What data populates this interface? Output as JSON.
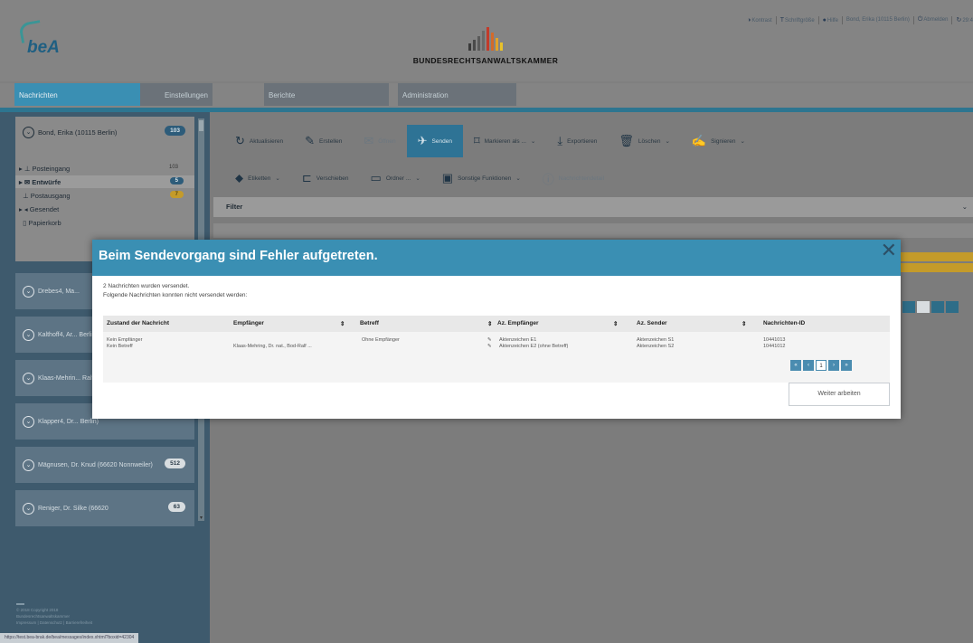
{
  "header": {
    "logo_text": "beA",
    "brand_name": "BUNDESRECHTSANWALTSKAMMER",
    "brand_bar_colors": [
      "#3a3a3a",
      "#4a4a4a",
      "#5a5a5a",
      "#6a6a6a",
      "#c23a2a",
      "#d36a2a",
      "#e2a22a",
      "#e8c22a"
    ],
    "topbar": [
      "Kontrast",
      "Schriftgröße",
      "Hilfe",
      "Bond, Erika (10115 Berlin)",
      "Abmelden",
      "29:4"
    ]
  },
  "nav": {
    "tabs": [
      "Nachrichten",
      "Einstellungen",
      "Berichte",
      "Administration"
    ]
  },
  "sidebar": {
    "account": {
      "name": "Bond, Erika (10115 Berlin)",
      "count": "103"
    },
    "folders": [
      {
        "label": "Posteingang",
        "count": "103"
      },
      {
        "label": "Entwürfe",
        "count": "5"
      },
      {
        "label": "Postausgang",
        "count": "7"
      },
      {
        "label": "Gesendet",
        "count": ""
      },
      {
        "label": "Papierkorb",
        "count": ""
      }
    ],
    "postboxes": [
      {
        "name": "Drebes4, Ma...",
        "count": ""
      },
      {
        "name": "Kalthoff4, Ar... Berlin)",
        "count": ""
      },
      {
        "name": "Klaas-Mehrin... Ralf (14169...",
        "count": ""
      },
      {
        "name": "Klapper4, Dr... Berlin)",
        "count": ""
      },
      {
        "name": "Mägnusen, Dr. Knud (66620 Nonnweiler)",
        "count": "512"
      },
      {
        "name": "Reniger, Dr. Silke (66620",
        "count": "63"
      }
    ],
    "copyright": [
      "© 2018 Copyright 2018",
      "Bundesrechtsanwaltskammer",
      "Impressum | Datenschutz | Barrierefreiheit"
    ]
  },
  "toolbar": {
    "row1": [
      {
        "icon": "refresh-icon",
        "label": "Aktualisieren"
      },
      {
        "icon": "pencil-icon",
        "label": "Erstellen"
      },
      {
        "icon": "envelope-icon",
        "label": "Öffnen"
      },
      {
        "icon": "paper-plane-icon",
        "label": "Senden"
      },
      {
        "icon": "bookmark-icon",
        "label": "Markieren als ..."
      },
      {
        "icon": "download-icon",
        "label": "Exportieren"
      },
      {
        "icon": "trash-icon",
        "label": "Löschen"
      },
      {
        "icon": "sign-icon",
        "label": "Signieren"
      }
    ],
    "row2": [
      {
        "icon": "tag-icon",
        "label": "Etiketten"
      },
      {
        "icon": "folder-open-icon",
        "label": "Verschieben"
      },
      {
        "icon": "folder-icon",
        "label": "Ordner ..."
      },
      {
        "icon": "more-icon",
        "label": "Sonstige Funktionen"
      },
      {
        "icon": "info-icon",
        "label": "Nachrichtendetail"
      }
    ]
  },
  "filter": {
    "label": "Filter"
  },
  "dialog": {
    "title": "Beim Sendevorgang sind Fehler aufgetreten.",
    "line1": "2 Nachrichten wurden versendet.",
    "line2": "Folgende Nachrichten konnten nicht versendet werden:",
    "columns": [
      "Zustand der Nachricht",
      "Empfänger",
      "Betreff",
      "Az. Empfänger",
      "Az. Sender",
      "Nachrichten-ID"
    ],
    "rows": [
      [
        "Kein Empfänger",
        "",
        "Ohne Empfänger",
        "Aktenzeichen E1",
        "Aktenzeichen S1",
        "10441013"
      ],
      [
        "Kein Betreff",
        "Klaas-Mehring, Dr. nat., Bod-Ralf ...",
        "",
        "Aktenzeichen E2 (ohne Betreff)",
        "Aktenzeichen S2",
        "10441012"
      ]
    ],
    "page": "1",
    "continue_label": "Weiter arbeiten"
  },
  "statusbar_url": "https://test.bea-brak.de/bea/messages/index.xhtml?boxid=42304"
}
